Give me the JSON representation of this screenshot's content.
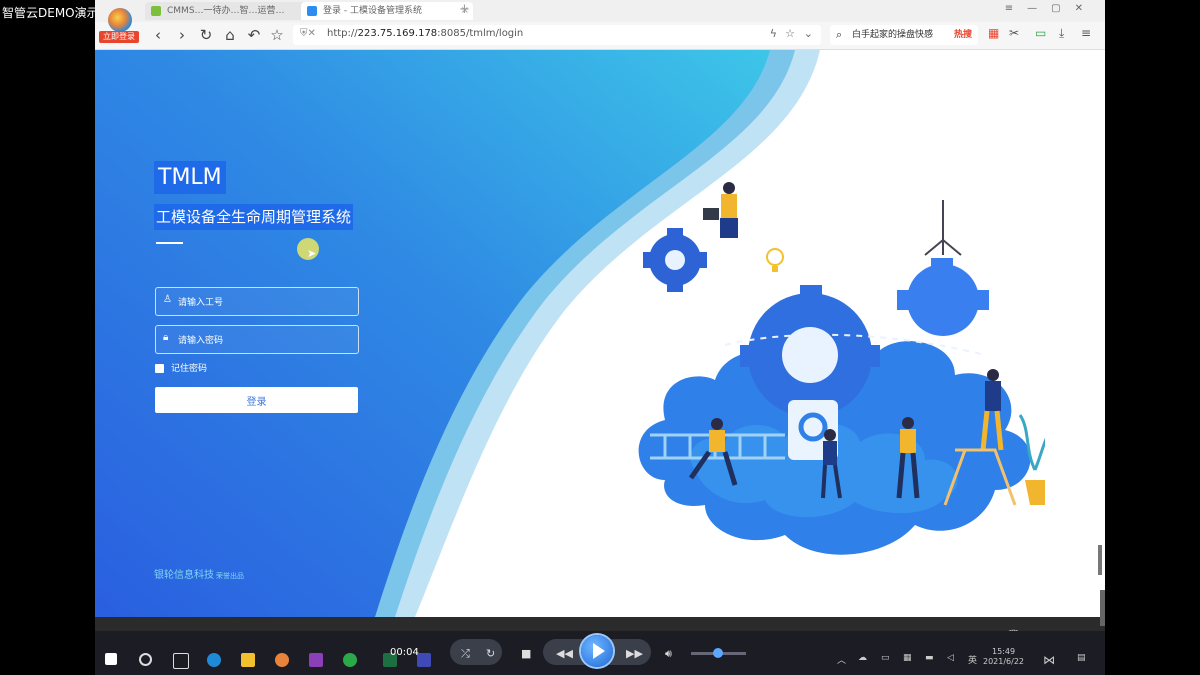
{
  "player": {
    "title": "智管云DEMO演示",
    "time": "00:04"
  },
  "browser": {
    "tabs": [
      {
        "label": "CMMS…一待办…智…运营…",
        "active": false
      },
      {
        "label": "登录 - 工模设备管理系统",
        "active": true
      }
    ],
    "badge_label": "立即登录",
    "url_host": "223.75.169.178",
    "url_prefix": "http://",
    "url_rest": ":8085/tmlm/login",
    "search_text": "白手起家的操盘快感",
    "search_hot": "热搜"
  },
  "login": {
    "app_short": "TMLM",
    "app_full": "工模设备全生命周期管理系统",
    "username_placeholder": "请输入工号",
    "password_placeholder": "请输入密码",
    "remember_label": "记住密码",
    "login_button": "登录",
    "footer_company": "银轮信息科技",
    "footer_suffix": "荣誉出品"
  },
  "taskbar": {
    "ime": "英",
    "clock_time": "15:49",
    "clock_date": "2021/6/22"
  },
  "colors": {
    "gradient_start": "#2a6ee6",
    "gradient_end": "#3dc6e8",
    "accent": "#1f6ae8",
    "footer_text": "#7fd6f2"
  }
}
